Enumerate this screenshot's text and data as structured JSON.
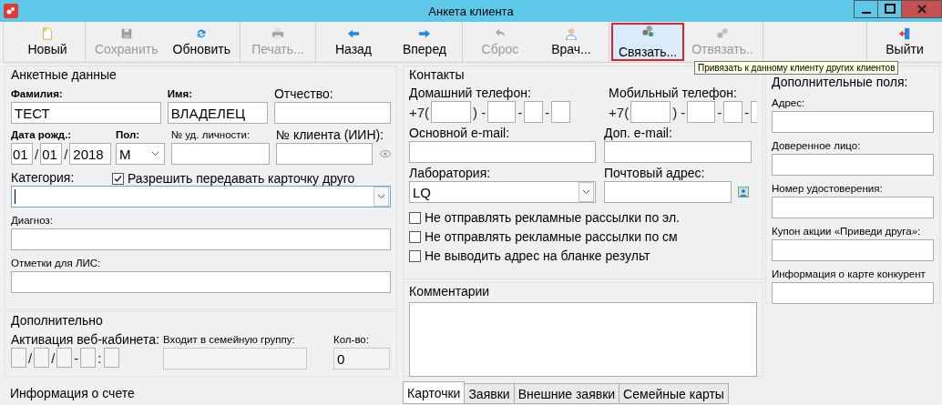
{
  "window": {
    "title": "Анкета клиента"
  },
  "toolbar": {
    "groups": [
      [
        {
          "label": "Новый",
          "disabled": false,
          "selected": false
        }
      ],
      [
        {
          "label": "Сохранить",
          "disabled": true,
          "selected": false
        },
        {
          "label": "Обновить",
          "disabled": false,
          "selected": false
        }
      ],
      [
        {
          "label": "Печать...",
          "disabled": true,
          "selected": false
        }
      ],
      [
        {
          "label": "Назад",
          "disabled": false,
          "selected": false
        },
        {
          "label": "Вперед",
          "disabled": false,
          "selected": false
        }
      ],
      [
        {
          "label": "Сброс",
          "disabled": true,
          "selected": false
        },
        {
          "label": "Врач...",
          "disabled": false,
          "selected": false
        }
      ],
      [
        {
          "label": "Связать...",
          "disabled": false,
          "selected": true
        },
        {
          "label": "Отвязать..",
          "disabled": true,
          "selected": false
        }
      ],
      [
        {
          "label": "Выйти",
          "disabled": false,
          "selected": false
        }
      ]
    ],
    "tooltip": "Привязать к данному клиенту других клиентов"
  },
  "personal": {
    "title": "Анкетные данные",
    "last_name": {
      "label": "Фамилия:",
      "required": true,
      "value": "ТЕСТ"
    },
    "first_name": {
      "label": "Имя:",
      "required": true,
      "value": "ВЛАДЕЛЕЦ"
    },
    "patronymic": {
      "label": "Отчество:",
      "required": false
    },
    "birth_date": {
      "label": "Дата рожд.:",
      "required": true,
      "parts": [
        "01",
        "01",
        "2018"
      ],
      "separators": [
        "/",
        "/"
      ]
    },
    "sex": {
      "label": "Пол:",
      "required": true,
      "value": "М"
    },
    "id_number": {
      "label": "№ уд. личности:",
      "required": false
    },
    "client_number": {
      "label": "№ клиента (ИИН):",
      "required": false
    },
    "category": {
      "label": "Категория:",
      "required": false
    },
    "allow_transfer": {
      "label": "Разрешить передавать карточку друго",
      "checked": true
    },
    "diagnosis": {
      "label": "Диагноз:",
      "required": false
    },
    "lis_notes": {
      "label": "Отметки для ЛИС:",
      "required": false
    }
  },
  "additional": {
    "title": "Дополнительно",
    "web_activation": {
      "label": "Активация веб-кабинета:",
      "separators": [
        "/",
        "/",
        "-",
        ":"
      ]
    },
    "family_group": {
      "label": "Входит в семейную группу:"
    },
    "count": {
      "label": "Кол-во:",
      "value": "0"
    }
  },
  "account": {
    "title": "Информация о счете"
  },
  "contacts": {
    "title": "Контакты",
    "home_phone": {
      "label": "Домашний телефон:",
      "prefix": "+7(",
      "separators": [
        ") -",
        "-",
        "-"
      ]
    },
    "mobile_phone": {
      "label": "Мобильный телефон:",
      "prefix": "+7(",
      "separators": [
        ") -",
        "-",
        "-"
      ]
    },
    "email": {
      "label": "Основной e-mail:"
    },
    "extra_email": {
      "label": "Доп. e-mail:"
    },
    "laboratory": {
      "label": "Лаборатория:",
      "value": "LQ"
    },
    "postal_address": {
      "label": "Почтовый адрес:"
    },
    "options": [
      {
        "label": "Не отправлять рекламные рассылки по эл.",
        "checked": false
      },
      {
        "label": "Не отправлять рекламные рассылки по см",
        "checked": false
      },
      {
        "label": "Не выводить адрес на бланке результ",
        "checked": false
      }
    ]
  },
  "comments": {
    "title": "Комментарии"
  },
  "tabs": [
    {
      "label": "Карточки",
      "selected": true
    },
    {
      "label": "Заявки",
      "selected": false
    },
    {
      "label": "Внешние заявки",
      "selected": false
    },
    {
      "label": "Семейные карты",
      "selected": false
    }
  ],
  "extra_fields": {
    "title": "Дополнительные поля:",
    "fields": [
      {
        "label": "Адрес:"
      },
      {
        "label": "Доверенное лицо:"
      },
      {
        "label": "Номер удостоверения:"
      },
      {
        "label": "Купон акции «Приведи друга»:"
      },
      {
        "label": "Информация о карте конкурент"
      }
    ]
  }
}
